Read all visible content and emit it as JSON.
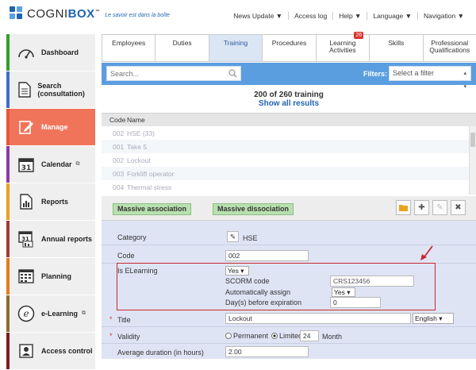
{
  "brand": {
    "name_left": "COGNI",
    "name_right": "BOX",
    "tm": "™",
    "tagline": "Le savoir est dans la boîte"
  },
  "topnav": [
    {
      "label": "News Update ▼"
    },
    {
      "label": "Access log"
    },
    {
      "label": "Help ▼"
    },
    {
      "label": "Language ▼"
    },
    {
      "label": "Navigation ▼"
    }
  ],
  "sidebar": [
    {
      "label": "Dashboard",
      "icon": "gauge-icon",
      "color": "#33a02c"
    },
    {
      "label": "Search (consultation)",
      "icon": "document-icon",
      "color": "#3c6fcf"
    },
    {
      "label": "Manage",
      "icon": "edit-icon",
      "color": "#e9553a",
      "active": true
    },
    {
      "label": "Calendar",
      "icon": "calendar-icon",
      "color": "#8e3aa5",
      "ext": "⧉"
    },
    {
      "label": "Reports",
      "icon": "report-icon",
      "color": "#e6a21e"
    },
    {
      "label": "Annual reports",
      "icon": "calendar-31-icon",
      "color": "#a03c3c"
    },
    {
      "label": "Planning",
      "icon": "planning-icon",
      "color": "#e47b1d"
    },
    {
      "label": "e-Learning",
      "icon": "elearning-icon",
      "color": "#8a6d2f",
      "ext": "⧉"
    },
    {
      "label": "Access control",
      "icon": "access-icon",
      "color": "#7a1e1e"
    }
  ],
  "tabs": [
    {
      "label": "Employees"
    },
    {
      "label": "Duties"
    },
    {
      "label": "Training",
      "active": true
    },
    {
      "label": "Procedures"
    },
    {
      "label": "Learning Activities",
      "badge": "26"
    },
    {
      "label": "Skills"
    },
    {
      "label": "Professional Qualifications"
    }
  ],
  "search": {
    "placeholder": "Search...",
    "filters_label": "Filters:",
    "filter_value": "Select a filter"
  },
  "results": {
    "count": "200 of 260 training",
    "show_all": "Show all results"
  },
  "grid": {
    "headers": [
      "Code",
      "Name"
    ],
    "rows": [
      {
        "code": "002",
        "name": "HSE  (33)"
      },
      {
        "code": "001",
        "name": "Take 5"
      },
      {
        "code": "002",
        "name": "Lockout"
      },
      {
        "code": "003",
        "name": "Forklift operator"
      },
      {
        "code": "004",
        "name": "Thermal stress"
      }
    ]
  },
  "actions": {
    "massive_association": "Massive association",
    "massive_dissociation": "Massive dissociation"
  },
  "form": {
    "category_label": "Category",
    "category_value": "HSE",
    "code_label": "Code",
    "code_value": "002",
    "elearning_label": "Is ELearning",
    "elearning_value": "Yes",
    "scorm_label": "SCORM code",
    "scorm_value": "CRS123456",
    "auto_assign_label": "Automatically assign",
    "auto_assign_value": "Yes",
    "days_label": "Day(s) before expiration",
    "days_value": "0",
    "title_label": "Title",
    "title_value": "Lockout",
    "language_value": "English",
    "validity_label": "Validity",
    "validity_permanent": "Permanent",
    "validity_limited": "Limited",
    "validity_number": "24",
    "validity_unit": "Month",
    "duration_label": "Average duration (in hours)",
    "duration_value": "2.00"
  },
  "colors": {
    "accent_blue": "#5b9ee0",
    "active_orange": "#f0745a",
    "highlight_red": "#c9282d"
  }
}
